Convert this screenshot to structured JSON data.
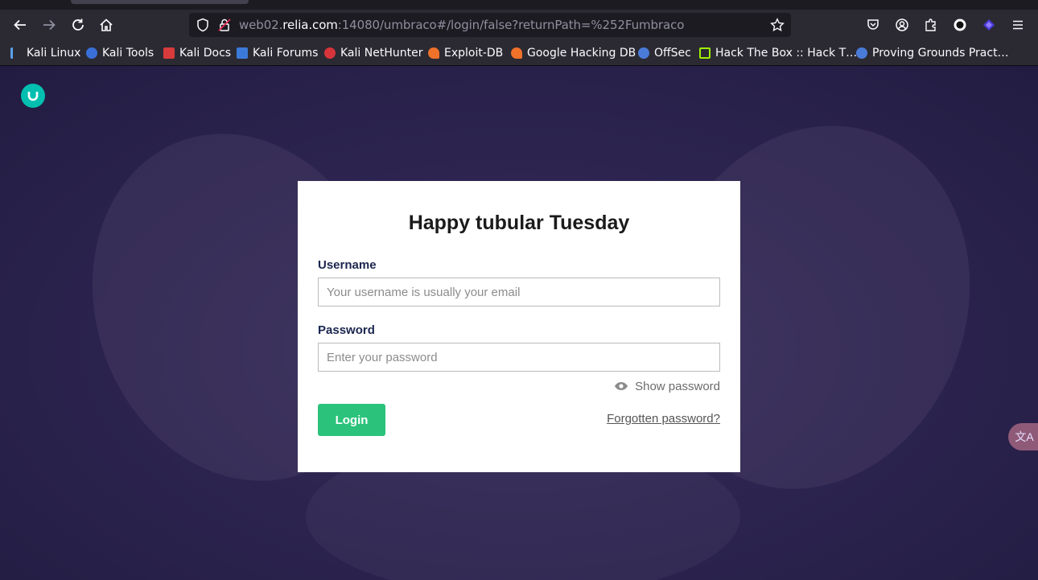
{
  "browser": {
    "url_prefix": "web02.",
    "url_host": "relia.com",
    "url_suffix": ":14080/umbraco#/login/false?returnPath=%252Fumbraco"
  },
  "bookmarks": [
    {
      "label": "Kali Linux",
      "color": "#5aa0e6"
    },
    {
      "label": "Kali Tools",
      "color": "#e0403a"
    },
    {
      "label": "Kali Docs",
      "color": "#d83b3b"
    },
    {
      "label": "Kali Forums",
      "color": "#3b7ad8"
    },
    {
      "label": "Kali NetHunter",
      "color": "#d8343b"
    },
    {
      "label": "Exploit-DB",
      "color": "#f0712a"
    },
    {
      "label": "Google Hacking DB",
      "color": "#f0712a"
    },
    {
      "label": "OffSec",
      "color": "#4a7bd8"
    },
    {
      "label": "Hack The Box :: Hack T…",
      "color": "#9fef00"
    },
    {
      "label": "Proving Grounds Pract…",
      "color": "#4a7bd8"
    }
  ],
  "login": {
    "greeting": "Happy tubular Tuesday",
    "username_label": "Username",
    "username_placeholder": "Your username is usually your email",
    "password_label": "Password",
    "password_placeholder": "Enter your password",
    "show_password": "Show password",
    "login_button": "Login",
    "forgot_link": "Forgotten password?"
  },
  "colors": {
    "login_button": "#2bc37c",
    "logo": "#03bfb0",
    "background": "#2d2550"
  },
  "translate_widget": "文A"
}
